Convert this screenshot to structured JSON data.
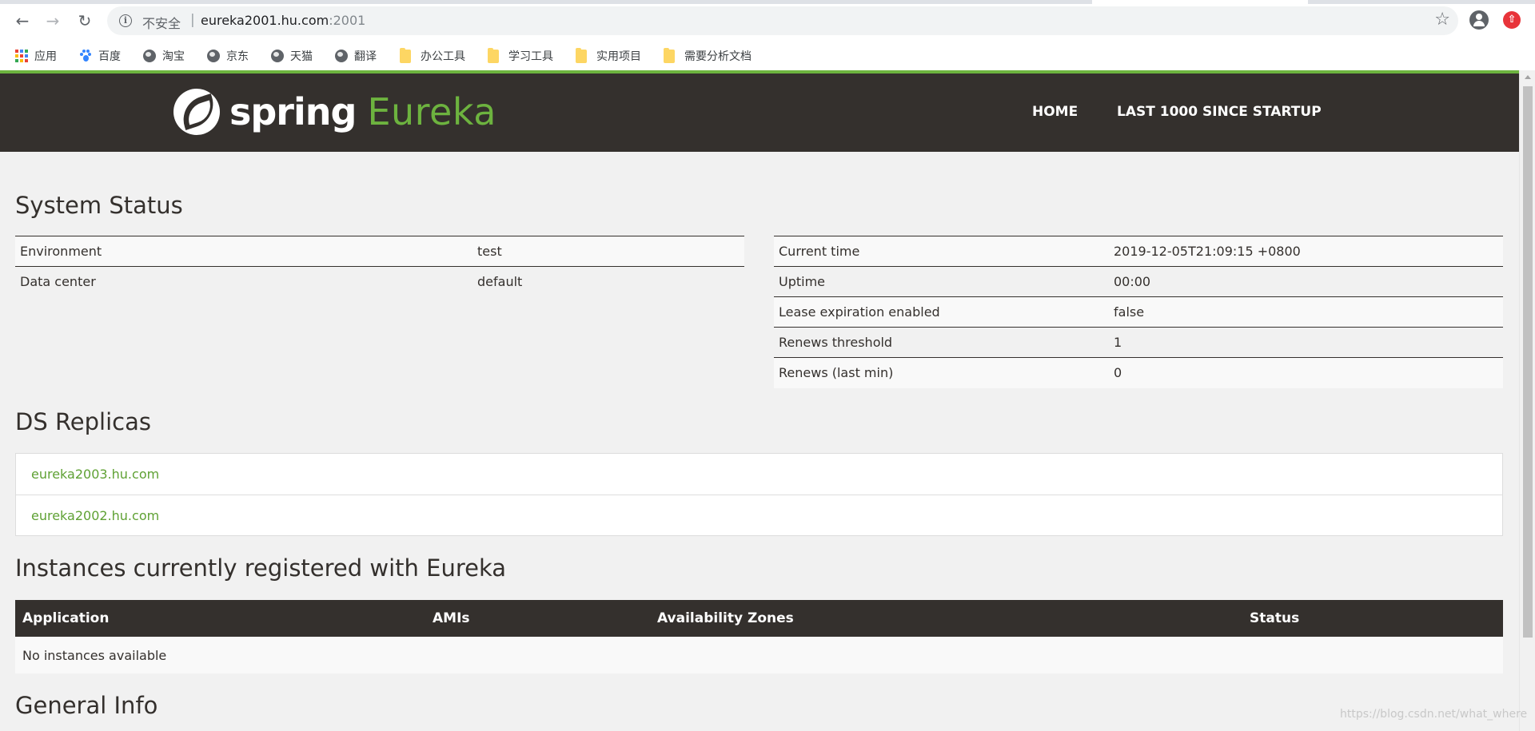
{
  "browser": {
    "security_label": "不安全",
    "separator": "|",
    "url_host": "eureka2001.hu.com",
    "url_port": ":2001",
    "icons": {
      "back": "arrow-left-icon",
      "forward": "arrow-right-icon",
      "reload": "reload-icon",
      "info": "info-icon",
      "star": "star-icon",
      "account": "account-icon",
      "extension": "extension-icon"
    }
  },
  "bookmarks": [
    {
      "label": "应用",
      "icon": "apps-icon"
    },
    {
      "label": "百度",
      "icon": "baidu-icon"
    },
    {
      "label": "淘宝",
      "icon": "globe-icon"
    },
    {
      "label": "京东",
      "icon": "globe-icon"
    },
    {
      "label": "天猫",
      "icon": "globe-icon"
    },
    {
      "label": "翻译",
      "icon": "globe-icon"
    },
    {
      "label": "办公工具",
      "icon": "folder-icon"
    },
    {
      "label": "学习工具",
      "icon": "folder-icon"
    },
    {
      "label": "实用项目",
      "icon": "folder-icon"
    },
    {
      "label": "需要分析文档",
      "icon": "folder-icon"
    }
  ],
  "header": {
    "logo_spring": "spring",
    "logo_eureka": "Eureka",
    "nav": [
      "HOME",
      "LAST 1000 SINCE STARTUP"
    ]
  },
  "system_status": {
    "title": "System Status",
    "left": [
      {
        "label": "Environment",
        "value": "test"
      },
      {
        "label": "Data center",
        "value": "default"
      }
    ],
    "right": [
      {
        "label": "Current time",
        "value": "2019-12-05T21:09:15 +0800"
      },
      {
        "label": "Uptime",
        "value": "00:00"
      },
      {
        "label": "Lease expiration enabled",
        "value": "false"
      },
      {
        "label": "Renews threshold",
        "value": "1"
      },
      {
        "label": "Renews (last min)",
        "value": "0"
      }
    ]
  },
  "ds_replicas": {
    "title": "DS Replicas",
    "items": [
      "eureka2003.hu.com",
      "eureka2002.hu.com"
    ]
  },
  "instances": {
    "title": "Instances currently registered with Eureka",
    "columns": [
      "Application",
      "AMIs",
      "Availability Zones",
      "Status"
    ],
    "empty_text": "No instances available"
  },
  "general_info": {
    "title": "General Info"
  },
  "watermark": "https://blog.csdn.net/what_where",
  "colors": {
    "navbar": "#34302d",
    "brand_green": "#6db33f",
    "link_green": "#5fa134",
    "page_bg": "#f1f1f1"
  }
}
